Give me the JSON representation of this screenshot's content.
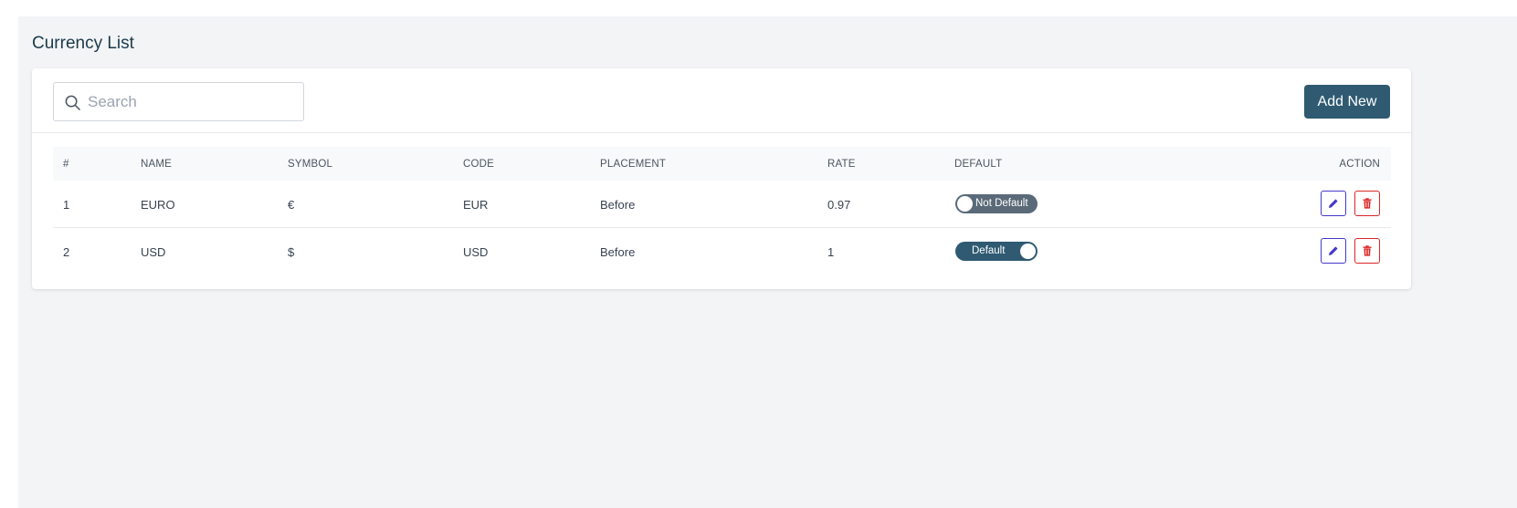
{
  "page": {
    "title": "Currency List"
  },
  "search": {
    "placeholder": "Search",
    "value": ""
  },
  "toolbar": {
    "add_label": "Add New"
  },
  "table": {
    "headers": [
      "#",
      "NAME",
      "SYMBOL",
      "CODE",
      "PLACEMENT",
      "RATE",
      "DEFAULT",
      "ACTION"
    ],
    "rows": [
      {
        "num": "1",
        "name": "EURO",
        "symbol": "€",
        "code": "EUR",
        "placement": "Before",
        "rate": "0.97",
        "default_label": "Not Default",
        "is_default": false
      },
      {
        "num": "2",
        "name": "USD",
        "symbol": "$",
        "code": "USD",
        "placement": "Before",
        "rate": "1",
        "default_label": "Default",
        "is_default": true
      }
    ]
  },
  "icons": {
    "search": "search-icon",
    "edit": "pencil-icon",
    "delete": "trash-icon"
  },
  "colors": {
    "primary": "#2f5a72",
    "toggle_off": "#5a6a78",
    "edit": "#4338ca",
    "delete": "#dc2626",
    "title": "#1b3a4b"
  }
}
